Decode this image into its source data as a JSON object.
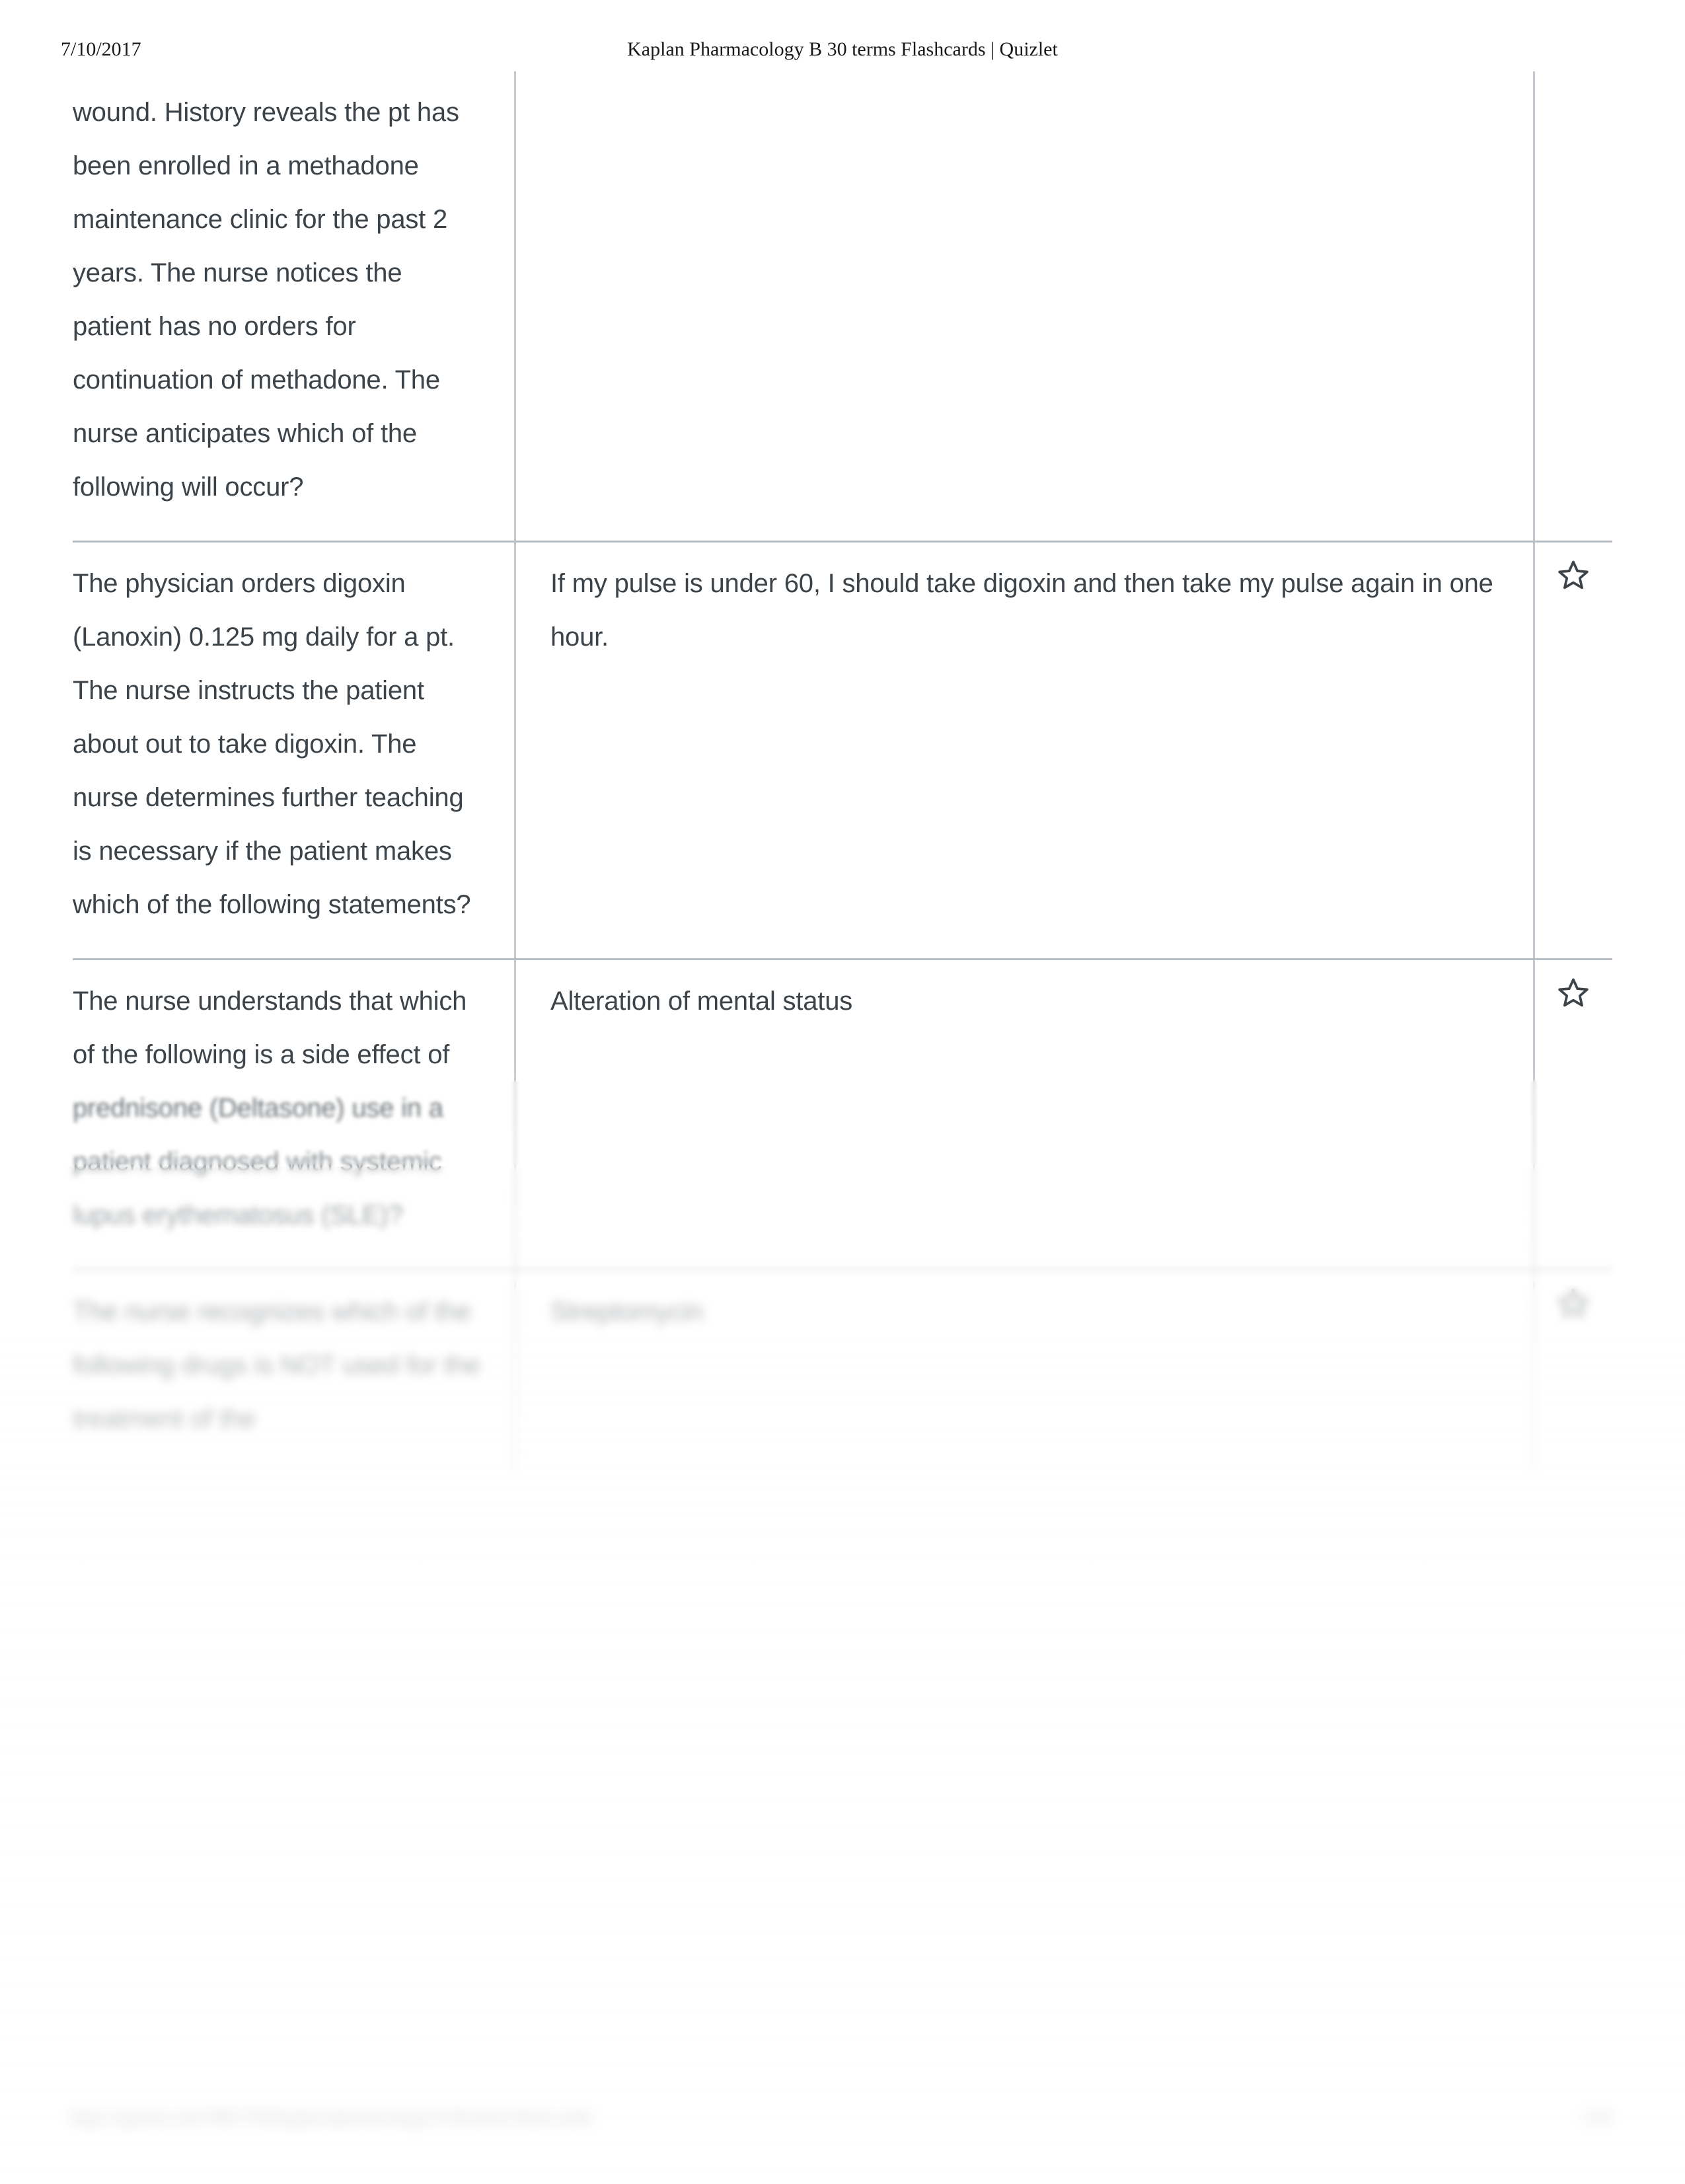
{
  "header": {
    "date": "7/10/2017",
    "title": "Kaplan Pharmacology B 30 terms Flashcards | Quizlet"
  },
  "cards": [
    {
      "term": "wound. History reveals the pt has been enrolled in a methadone maintenance clinic for the past 2 years. The nurse notices the patient has no orders for continuation of methadone. The nurse anticipates which of the following will occur?",
      "definition": "",
      "star": "star-icon",
      "starred": false
    },
    {
      "term": "The physician orders digoxin (Lanoxin) 0.125 mg daily for a pt. The nurse instructs the patient about out to take digoxin. The nurse determines further teaching is necessary if the patient makes which of the following statements?",
      "definition": "If my pulse is under 60, I should take digoxin and then take my pulse again in one hour.",
      "star": "star-icon",
      "starred": false
    },
    {
      "term": "The nurse understands that which of the following is a side effect of prednisone (Deltasone) use in a patient diagnosed with systemic lupus erythematosus (SLE)?",
      "definition": "Alteration of mental status",
      "star": "star-icon",
      "starred": false
    },
    {
      "term": "The nurse recognizes which of the following drugs is NOT used for the treatment of the",
      "definition": "Streptomycin",
      "star": "star-icon",
      "starred": false
    }
  ],
  "footer": {
    "url": "https://quizlet.com/79817790/kaplan-pharmacology-b-30-terms-flash-cards/",
    "page": "1/10"
  },
  "colors": {
    "text": "#3c4349",
    "rule": "#b6bcc4",
    "column_divider": "#c3c8ce",
    "print_text": "#1a1a1a"
  }
}
